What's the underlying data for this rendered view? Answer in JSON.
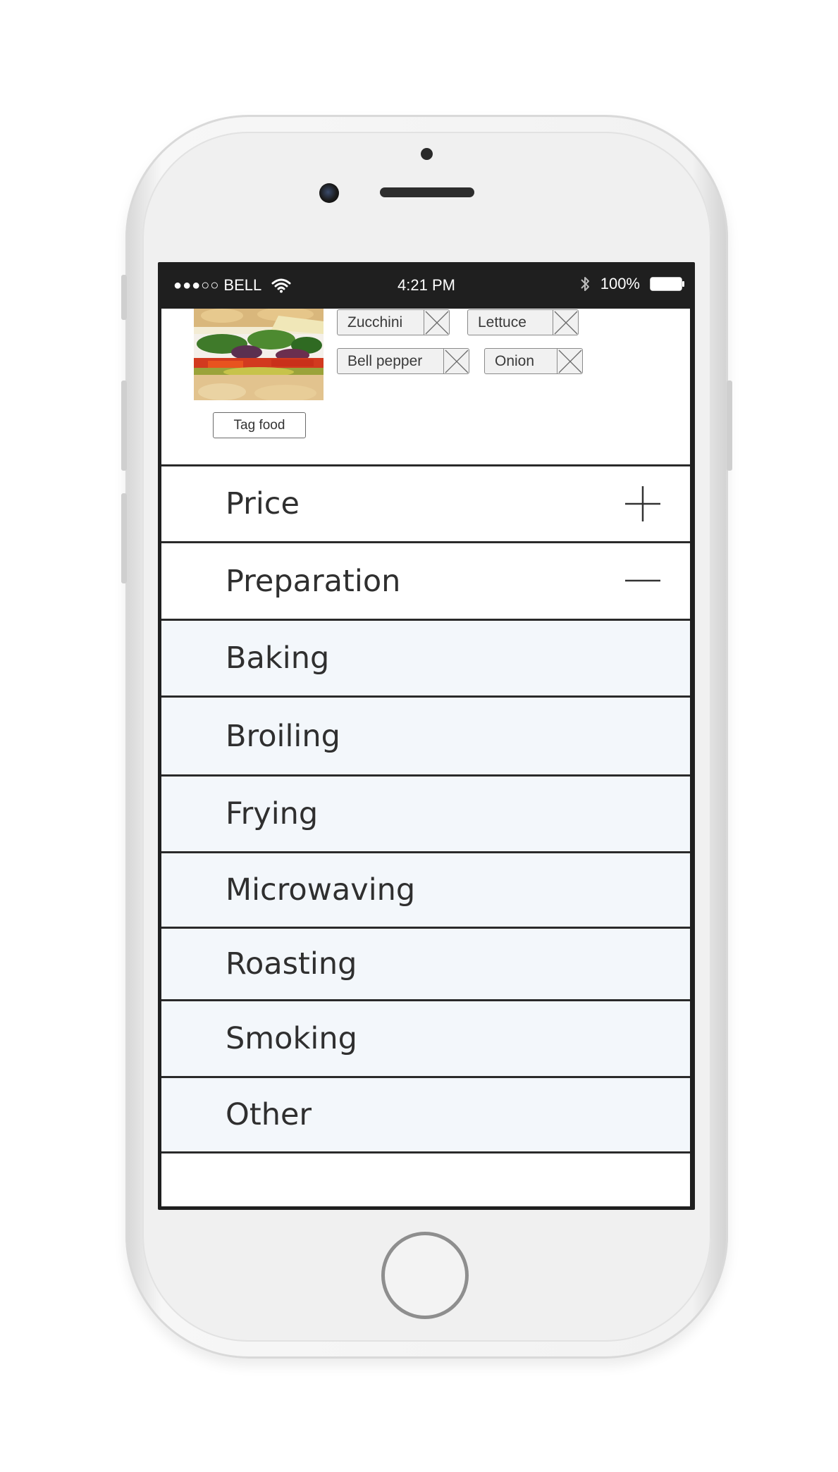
{
  "status_bar": {
    "carrier": "BELL",
    "signal_dots": "●●●○○",
    "time": "4:21 PM",
    "battery": "100%"
  },
  "food_photo": {
    "icon": "sandwich-photo"
  },
  "tag_button": {
    "label": "Tag food"
  },
  "tags": [
    {
      "label": "Zucchini"
    },
    {
      "label": "Lettuce"
    },
    {
      "label": "Bell pepper"
    },
    {
      "label": "Onion"
    }
  ],
  "sections": {
    "price": {
      "label": "Price",
      "icon": "plus-icon",
      "expanded": false
    },
    "preparation": {
      "label": "Preparation",
      "icon": "minus-icon",
      "expanded": true
    }
  },
  "preparation_options": [
    {
      "label": "Baking"
    },
    {
      "label": "Broiling"
    },
    {
      "label": "Frying"
    },
    {
      "label": "Microwaving"
    },
    {
      "label": "Roasting"
    },
    {
      "label": "Smoking"
    },
    {
      "label": "Other"
    }
  ],
  "colors": {
    "option_background": "#f3f7fb",
    "status_bar": "#1f1f1f",
    "text": "#2f2f2f"
  }
}
